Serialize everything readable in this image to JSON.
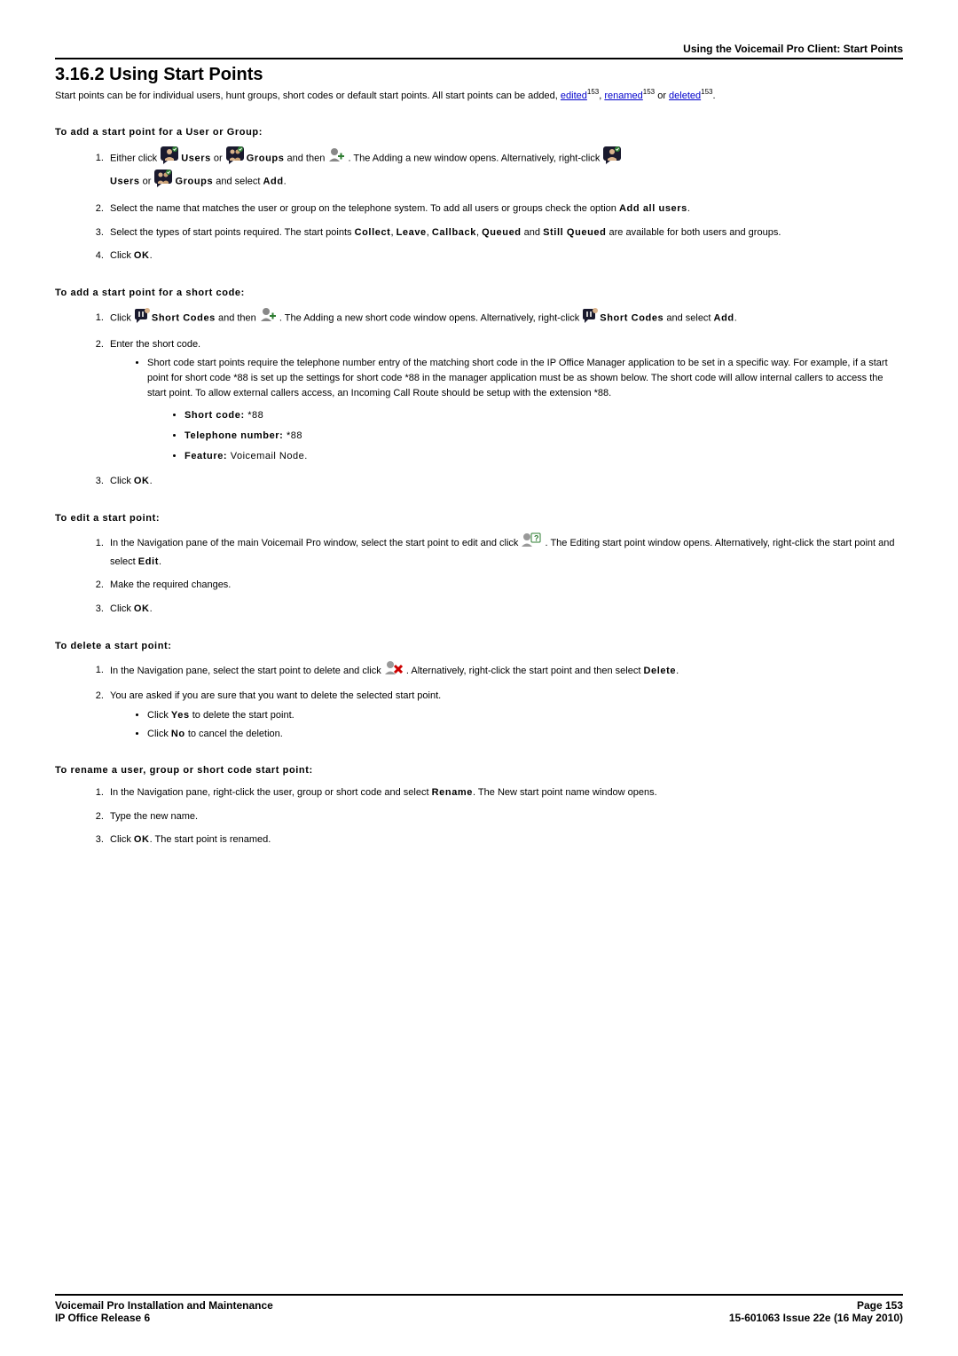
{
  "header": {
    "right": "Using the Voicemail Pro Client: Start Points"
  },
  "section": {
    "number_title": "3.16.2 Using Start Points",
    "intro_pre": "Start points can be for individual users, hunt groups, short codes or default start points. All start points can be added, ",
    "link_edited": "edited",
    "pg_edited": "153",
    "sep1": ", ",
    "link_renamed": "renamed",
    "pg_renamed": "153",
    "sep2": " or ",
    "link_deleted": "deleted",
    "pg_deleted": "153",
    "intro_post": "."
  },
  "add_user_group": {
    "heading": "To add a start point for a User or Group:",
    "step1_a": "Either click ",
    "step1_users": "Users",
    "step1_b": " or ",
    "step1_groups": "Groups",
    "step1_c": " and then ",
    "step1_d": ". The Adding a new window opens. Alternatively, right-click ",
    "step1_users2": "Users",
    "step1_e": " or ",
    "step1_groups2": "Groups",
    "step1_f": " and select ",
    "step1_add": "Add",
    "step1_g": ".",
    "step2_a": "Select the name that matches the user or group on the telephone system. To add all users or groups check the option ",
    "step2_b": "Add all users",
    "step2_c": ".",
    "step3_a": "Select the types of start points required. The start points ",
    "step3_collect": "Collect",
    "step3_s1": ", ",
    "step3_leave": "Leave",
    "step3_s2": ", ",
    "step3_callback": "Callback",
    "step3_s3": ", ",
    "step3_queued": "Queued",
    "step3_s4": " and ",
    "step3_stillq": "Still Queued",
    "step3_b": " are available for both users and groups.",
    "step4_a": "Click ",
    "step4_ok": "OK",
    "step4_b": "."
  },
  "add_short_code": {
    "heading": "To add a start point for a short code:",
    "step1_a": "Click ",
    "step1_sc": "Short Codes",
    "step1_b": " and then ",
    "step1_c": ". The Adding a new short code window opens. Alternatively, right-click ",
    "step1_sc2": "Short Codes",
    "step1_d": " and select ",
    "step1_add": "Add",
    "step1_e": ".",
    "step2": "Enter the short code.",
    "bullet_text": "Short code start points require the telephone number entry of the matching short code in the IP Office Manager application to be set in a specific way. For example, if a start point for short code *88 is set up the settings for short code *88 in the manager application must be as shown below. The short code will allow internal callers to access the start point. To allow external callers access, an Incoming Call Route should be setup with the extension *88.",
    "inner1_label": "Short code:",
    "inner1_val": " *88",
    "inner2_label": "Telephone number:",
    "inner2_val": " *88",
    "inner3_label": "Feature:",
    "inner3_val": " Voicemail Node.",
    "step3_a": "Click ",
    "step3_ok": "OK",
    "step3_b": "."
  },
  "edit_sp": {
    "heading": "To edit a start point:",
    "step1_a": "In the Navigation pane of the main Voicemail Pro window, select the start point to edit and click ",
    "step1_b": ". The Editing start point window opens. Alternatively, right-click the start point and select ",
    "step1_edit": "Edit",
    "step1_c": ".",
    "step2": "Make the required changes.",
    "step3_a": "Click ",
    "step3_ok": "OK",
    "step3_b": "."
  },
  "delete_sp": {
    "heading": "To delete a start point:",
    "step1_a": "In the Navigation pane, select the start point to delete and click ",
    "step1_b": ". Alternatively, right-click the start point and then select ",
    "step1_delete": "Delete",
    "step1_c": ".",
    "step2": "You are asked if you are sure that you want to delete the selected start point.",
    "bullet1_a": "Click ",
    "bullet1_yes": "Yes",
    "bullet1_b": " to delete the start point.",
    "bullet2_a": "Click ",
    "bullet2_no": "No",
    "bullet2_b": " to cancel the deletion."
  },
  "rename_sp": {
    "heading": "To rename a user, group or short code start point:",
    "step1_a": "In the Navigation pane, right-click the user, group or short code and select ",
    "step1_rename": "Rename",
    "step1_b": ". The New start point name window opens.",
    "step2": "Type the new name.",
    "step3_a": "Click ",
    "step3_ok": "OK",
    "step3_b": ". The start point is renamed."
  },
  "footer": {
    "left1": "Voicemail Pro Installation and Maintenance",
    "left2": "IP Office Release 6",
    "right1": "Page 153",
    "right2": "15-601063 Issue 22e (16 May 2010)"
  }
}
